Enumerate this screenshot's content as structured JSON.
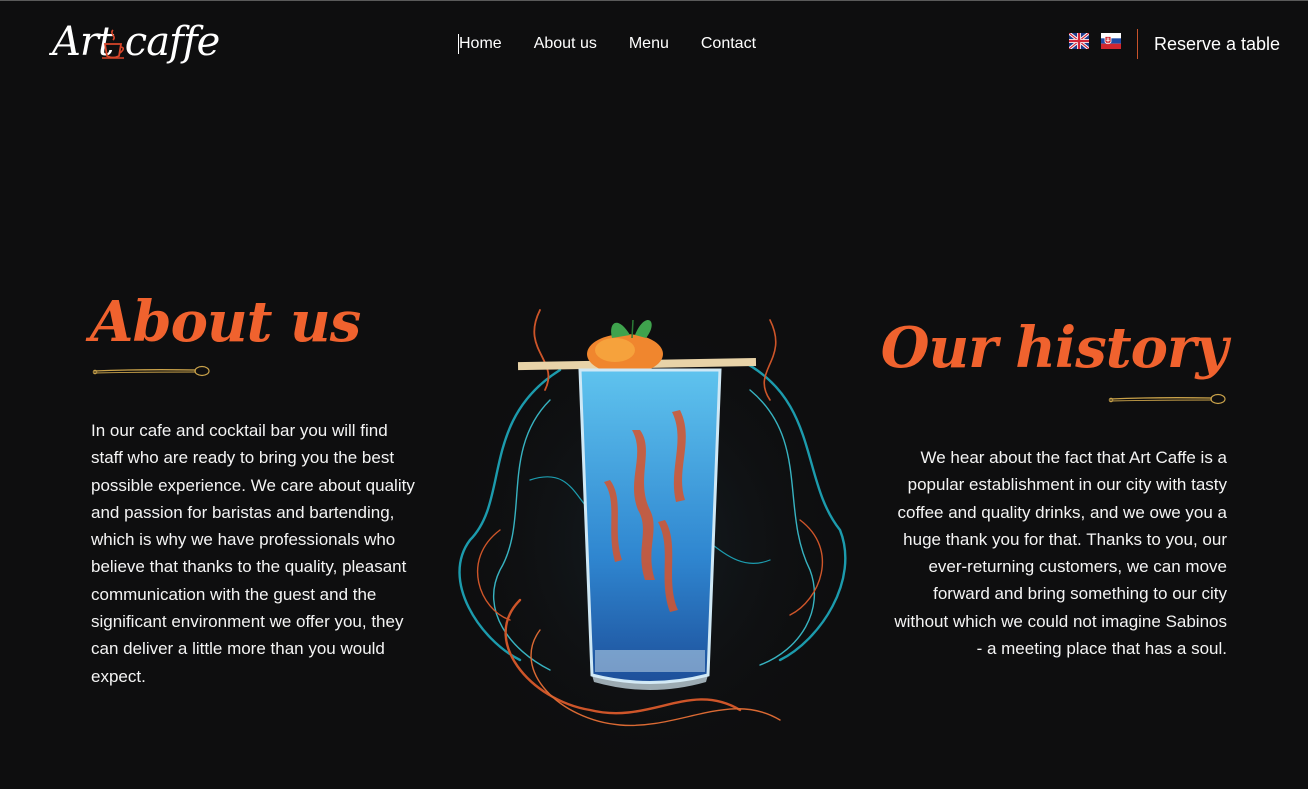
{
  "header": {
    "logo_text": "Art caffe",
    "nav": [
      "Home",
      "About us",
      "Menu",
      "Contact"
    ],
    "languages": [
      "English",
      "Slovak"
    ],
    "reserve_label": "Reserve a table"
  },
  "about": {
    "title": "About us",
    "text": "In our cafe and cocktail bar you will find staff who are ready to bring you the best possible experience. We care about quality and passion for baristas and bartending, which is why we have professionals who believe that thanks to the quality, pleasant communication with the guest and the significant environment we offer you, they can deliver a little more than you would expect."
  },
  "history": {
    "title": "Our history",
    "text": "We hear about the fact that Art Caffe is a popular establishment in our city with tasty coffee and quality drinks, and we owe you a huge thank you for that. Thanks to you, our ever-returning customers, we can move forward and bring something to our city without which we could not imagine Sabinos - a meeting place that has a soul."
  },
  "colors": {
    "background": "#0e0e0f",
    "accent": "#f0622e",
    "gold": "#c9a24a",
    "cyan_smoke": "#1fb4c9"
  },
  "icons": {
    "uk_flag": "uk-flag-icon",
    "sk_flag": "sk-flag-icon",
    "spoon": "spoon-divider-icon",
    "cup": "coffee-cup-icon"
  }
}
